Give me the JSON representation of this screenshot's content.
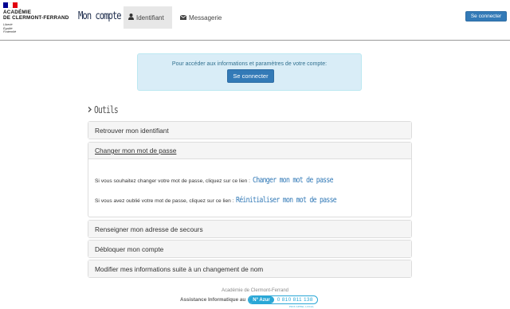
{
  "header": {
    "logo_line1": "ACADÉMIE",
    "logo_line2": "DE CLERMONT-FERRAND",
    "motto": [
      "Liberté",
      "Égalité",
      "Fraternité"
    ],
    "brand": "Mon compte",
    "tabs": [
      {
        "label": "Identifiant",
        "icon": "user-icon",
        "active": true
      },
      {
        "label": "Messagerie",
        "icon": "envelope-icon",
        "active": false
      }
    ],
    "login_button": "Se connecter"
  },
  "info": {
    "text": "Pour accéder aux informations et paramètres de votre compte:",
    "button": "Se connecter"
  },
  "tools": {
    "heading": "Outils",
    "panels": [
      {
        "title": "Retrouver mon identifiant",
        "open": false
      },
      {
        "title": "Changer mon mot de passe",
        "open": true,
        "line1_text": "Si vous souhaitez changer votre mot de passe, cliquez sur ce lien :",
        "line1_link": "Changer mon mot de passe",
        "line2_text": "Si vous avez oublié votre mot de passe, cliquez sur ce lien :",
        "line2_link": "Réinitialiser mon mot de passe"
      },
      {
        "title": "Renseigner mon adresse de secours",
        "open": false
      },
      {
        "title": "Débloquer mon compte",
        "open": false
      },
      {
        "title": "Modifier mes informations suite à un changement de nom",
        "open": false
      }
    ]
  },
  "footer": {
    "academy": "Académie de Clermont-Ferrand",
    "assist_label": "Assistance Informatique au",
    "azur_badge": "N° Azur",
    "azur_number": "0 810 811 138",
    "azur_sub": "PRIX APPEL LOCAL"
  },
  "colors": {
    "primary": "#337ab7",
    "info_bg": "#d9edf7",
    "info_text": "#31708f",
    "azur": "#2aa7d6"
  }
}
